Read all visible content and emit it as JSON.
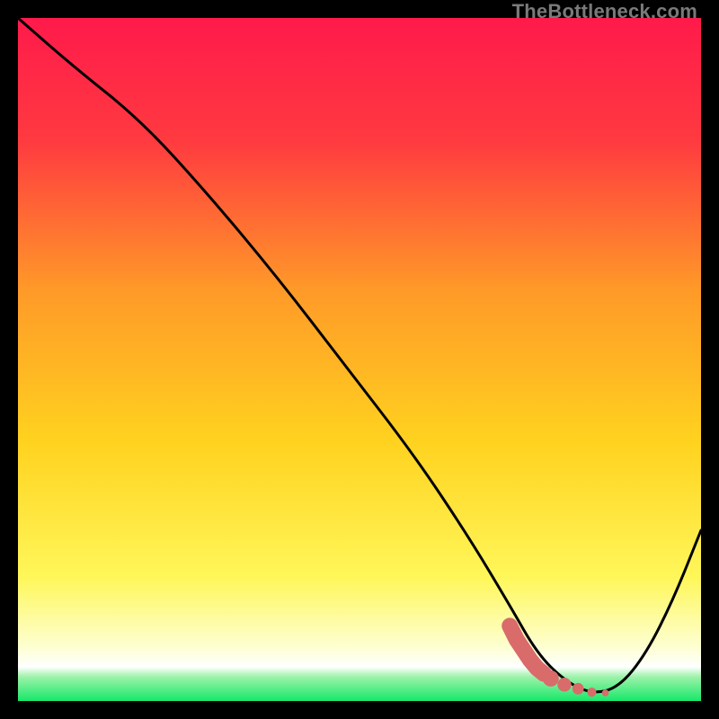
{
  "watermark": "TheBottleneck.com",
  "colors": {
    "bg": "#000000",
    "grad_top": "#ff1a4b",
    "grad_high": "#ff6a2a",
    "grad_mid": "#ffd21f",
    "grad_low": "#fff95a",
    "grad_pale": "#fdffd0",
    "grad_green": "#17e86a",
    "curve": "#000000",
    "marker": "#d96b6b"
  },
  "chart_data": {
    "type": "line",
    "title": "",
    "xlabel": "",
    "ylabel": "",
    "xlim": [
      0,
      100
    ],
    "ylim": [
      0,
      100
    ],
    "series": [
      {
        "name": "bottleneck-curve",
        "x": [
          0,
          8,
          18,
          28,
          38,
          48,
          58,
          66,
          72,
          76,
          80,
          84,
          88,
          92,
          96,
          100
        ],
        "y": [
          100,
          93,
          85,
          74,
          62,
          49,
          36,
          24,
          14,
          7,
          3,
          1,
          2,
          7,
          15,
          25
        ]
      }
    ],
    "markers": {
      "name": "optimal-zone",
      "x": [
        72,
        73,
        74,
        75,
        76,
        77,
        78,
        80,
        82,
        84,
        86
      ],
      "y": [
        11,
        9,
        7.5,
        6,
        4.8,
        4,
        3.3,
        2.4,
        1.8,
        1.3,
        1.2
      ]
    },
    "gradient_bands": [
      {
        "y_from": 100,
        "y_to": 6,
        "note": "red→orange→yellow vertical gradient"
      },
      {
        "y_from": 6,
        "y_to": 2,
        "note": "pale yellow / near-white band"
      },
      {
        "y_from": 2,
        "y_to": 0,
        "note": "green band at bottom"
      }
    ]
  }
}
